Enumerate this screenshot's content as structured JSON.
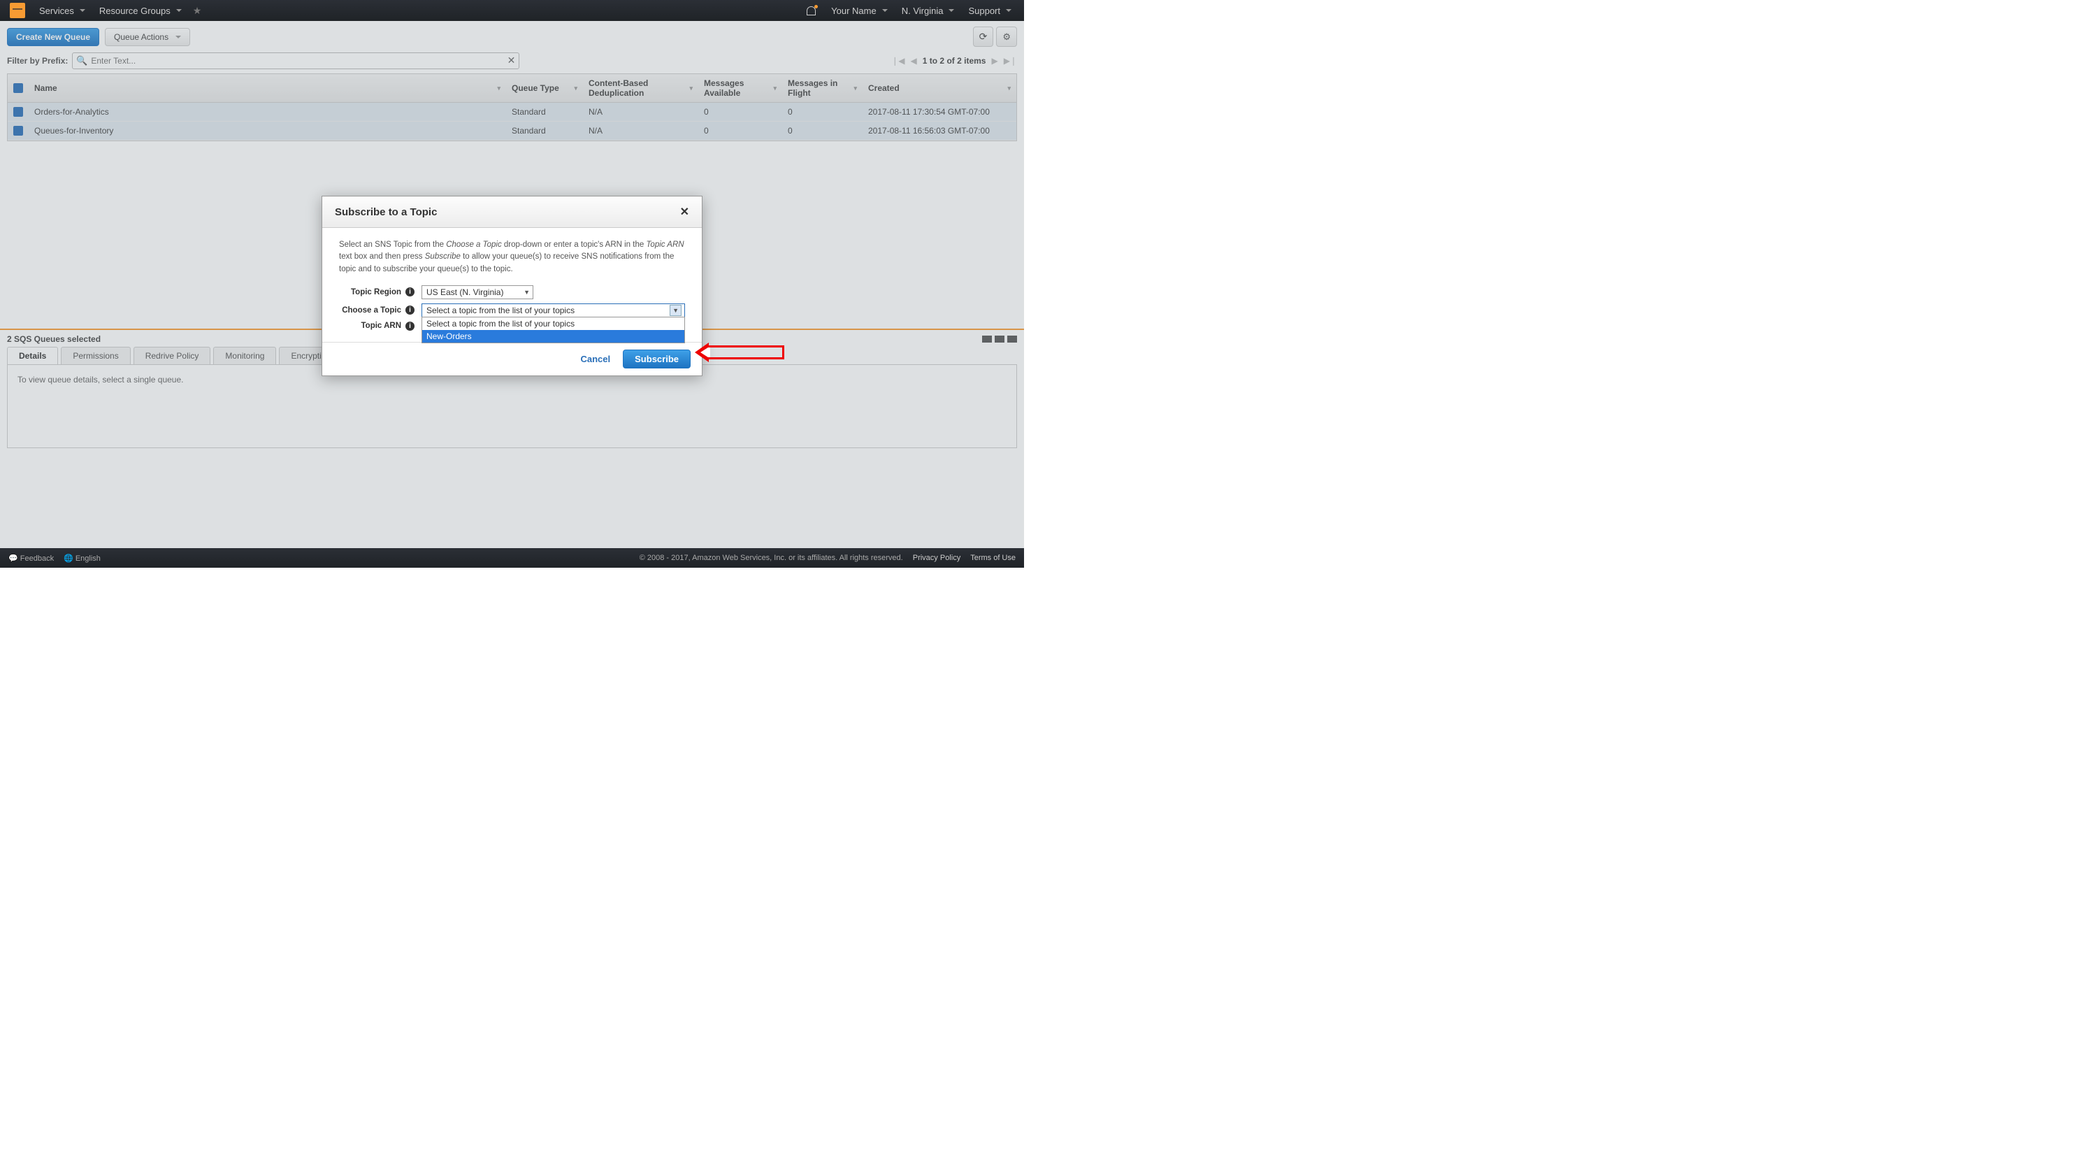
{
  "topnav": {
    "services": "Services",
    "resource_groups": "Resource Groups",
    "user": "Your Name",
    "region": "N. Virginia",
    "support": "Support"
  },
  "toolbar": {
    "create": "Create New Queue",
    "actions": "Queue Actions"
  },
  "filter": {
    "label": "Filter by Prefix:",
    "placeholder": "Enter Text...",
    "pager": "1 to 2 of 2 items"
  },
  "columns": {
    "name": "Name",
    "qtype": "Queue Type",
    "cbd": "Content-Based Deduplication",
    "ma": "Messages Available",
    "mif": "Messages in Flight",
    "created": "Created"
  },
  "rows": [
    {
      "name": "Orders-for-Analytics",
      "qtype": "Standard",
      "cbd": "N/A",
      "ma": "0",
      "mif": "0",
      "created": "2017-08-11 17:30:54 GMT-07:00"
    },
    {
      "name": "Queues-for-Inventory",
      "qtype": "Standard",
      "cbd": "N/A",
      "ma": "0",
      "mif": "0",
      "created": "2017-08-11 16:56:03 GMT-07:00"
    }
  ],
  "details": {
    "selected": "2 SQS Queues selected",
    "tabs": {
      "details": "Details",
      "permissions": "Permissions",
      "redrive": "Redrive Policy",
      "monitoring": "Monitoring",
      "encryption": "Encryption"
    },
    "body": "To view queue details, select a single queue."
  },
  "modal": {
    "title": "Subscribe to a Topic",
    "desc1": "Select an SNS Topic from the ",
    "desc_em1": "Choose a Topic",
    "desc2": " drop-down or enter a topic's ARN in the ",
    "desc_em2": "Topic ARN",
    "desc3": " text box and then press ",
    "desc_em3": "Subscribe",
    "desc4": " to allow your queue(s) to receive SNS notifications from the topic and to subscribe your queue(s) to the topic.",
    "region_label": "Topic Region",
    "region_value": "US East (N. Virginia)",
    "choose_label": "Choose a Topic",
    "choose_value": "Select a topic from the list of your topics",
    "arn_label": "Topic ARN",
    "options": {
      "placeholder": "Select a topic from the list of your topics",
      "opt1": "New-Orders"
    },
    "cancel": "Cancel",
    "subscribe": "Subscribe"
  },
  "footer": {
    "feedback": "Feedback",
    "lang": "English",
    "copyright": "© 2008 - 2017, Amazon Web Services, Inc. or its affiliates. All rights reserved.",
    "privacy": "Privacy Policy",
    "terms": "Terms of Use"
  }
}
